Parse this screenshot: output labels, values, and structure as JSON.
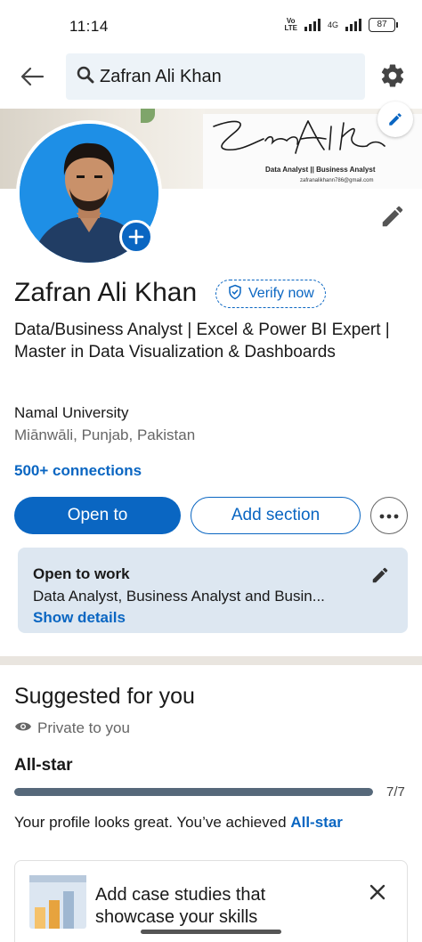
{
  "status_bar": {
    "time": "11:14",
    "network": "4G",
    "volte_top": "Vo",
    "volte_bottom": "LTE",
    "battery": "87"
  },
  "top_bar": {
    "search_value": "Zafran Ali Khan"
  },
  "banner": {
    "signature": "Zafran Ali Khan",
    "role": "Data Analyst || Business Analyst",
    "email": "zafranalikhann786@gmail.com"
  },
  "profile": {
    "name": "Zafran Ali Khan",
    "verify_label": "Verify now",
    "headline": "Data/Business Analyst | Excel & Power BI Expert | Master in Data Visualization & Dashboards",
    "education": "Namal University",
    "location": "Miānwāli, Punjab, Pakistan",
    "connections": "500+ connections"
  },
  "actions": {
    "open_to": "Open to",
    "add_section": "Add section"
  },
  "open_to_work": {
    "title": "Open to work",
    "description": "Data Analyst, Business Analyst and Busin...",
    "show_details": "Show details"
  },
  "suggested": {
    "title": "Suggested for you",
    "privacy": "Private to you",
    "level_label": "All-star",
    "progress_text": "7/7",
    "progress_fraction": 1.0,
    "message_prefix": "Your profile looks great. You’ve achieved ",
    "message_link": "All-star",
    "card_text": "Add case studies that showcase your skills"
  },
  "colors": {
    "accent": "#0a66c2",
    "progress_fill": "#56687a",
    "card_bg": "#dde7f1"
  }
}
